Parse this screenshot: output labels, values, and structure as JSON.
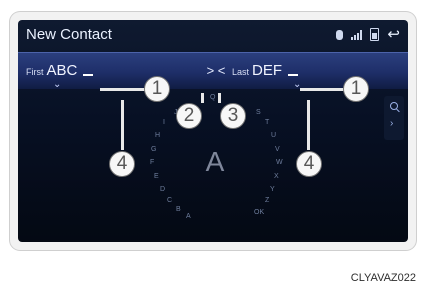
{
  "screen": {
    "title": "New Contact",
    "status_icons": [
      "bluetooth-icon",
      "signal-icon",
      "battery-icon",
      "back-icon"
    ]
  },
  "fields": {
    "first_label": "First",
    "first_value": "ABC",
    "last_label": "Last",
    "last_value": "DEF",
    "move_arrows": "> <"
  },
  "keyboard": {
    "center_letter": "A",
    "left_arc": [
      "J",
      "I",
      "H",
      "G",
      "F",
      "E",
      "D",
      "C",
      "B",
      "A"
    ],
    "right_arc": [
      "S",
      "T",
      "U",
      "V",
      "W",
      "X",
      "Y",
      "Z",
      "OK"
    ],
    "top": "Q"
  },
  "callouts": [
    "1",
    "2",
    "3",
    "1",
    "4",
    "4"
  ],
  "caption": "CLYAVAZ022"
}
